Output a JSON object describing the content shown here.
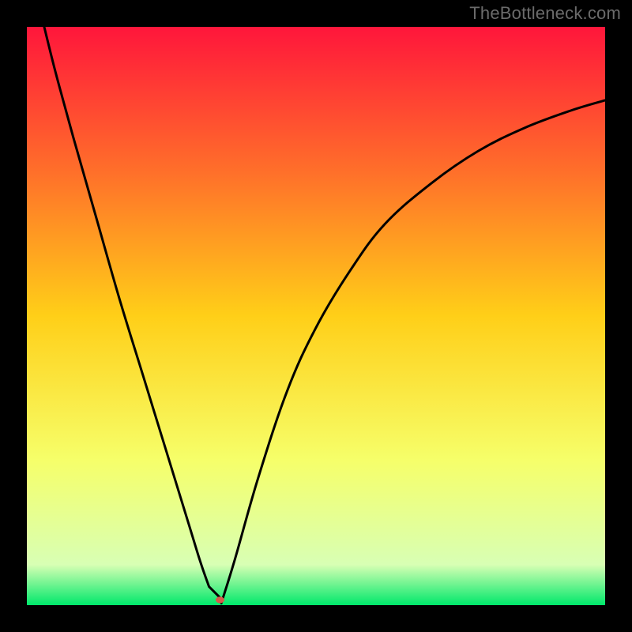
{
  "attribution": "TheBottleneck.com",
  "chart_data": {
    "type": "line",
    "title": "",
    "xlabel": "",
    "ylabel": "",
    "xlim": [
      0,
      100
    ],
    "ylim": [
      0,
      100
    ],
    "background_gradient": {
      "stops": [
        {
          "offset": 0,
          "color": "#ff163b"
        },
        {
          "offset": 25,
          "color": "#ff6f2a"
        },
        {
          "offset": 50,
          "color": "#ffcf18"
        },
        {
          "offset": 75,
          "color": "#f6ff6a"
        },
        {
          "offset": 93,
          "color": "#d8ffb4"
        },
        {
          "offset": 100,
          "color": "#00e86b"
        }
      ]
    },
    "series": [
      {
        "name": "curve",
        "color": "#000000",
        "x": [
          3,
          5,
          8,
          12,
          16,
          20,
          24,
          28,
          30,
          31.5,
          32.3,
          33.8,
          36,
          40,
          45,
          50,
          56,
          62,
          70,
          78,
          86,
          94,
          100
        ],
        "y": [
          100,
          92,
          81,
          67,
          53,
          40,
          27,
          14,
          7.5,
          3.2,
          0.9,
          0.9,
          8,
          22,
          37,
          48,
          58,
          66,
          73,
          78.5,
          82.5,
          85.5,
          87.3
        ]
      }
    ],
    "flat_segment": {
      "x0": 31.5,
      "x1": 33.8,
      "y": 0.9
    },
    "marker": {
      "x": 33.4,
      "y": 0.9,
      "color": "#d85a4a",
      "rx": 5.5,
      "ry": 4.2
    }
  }
}
